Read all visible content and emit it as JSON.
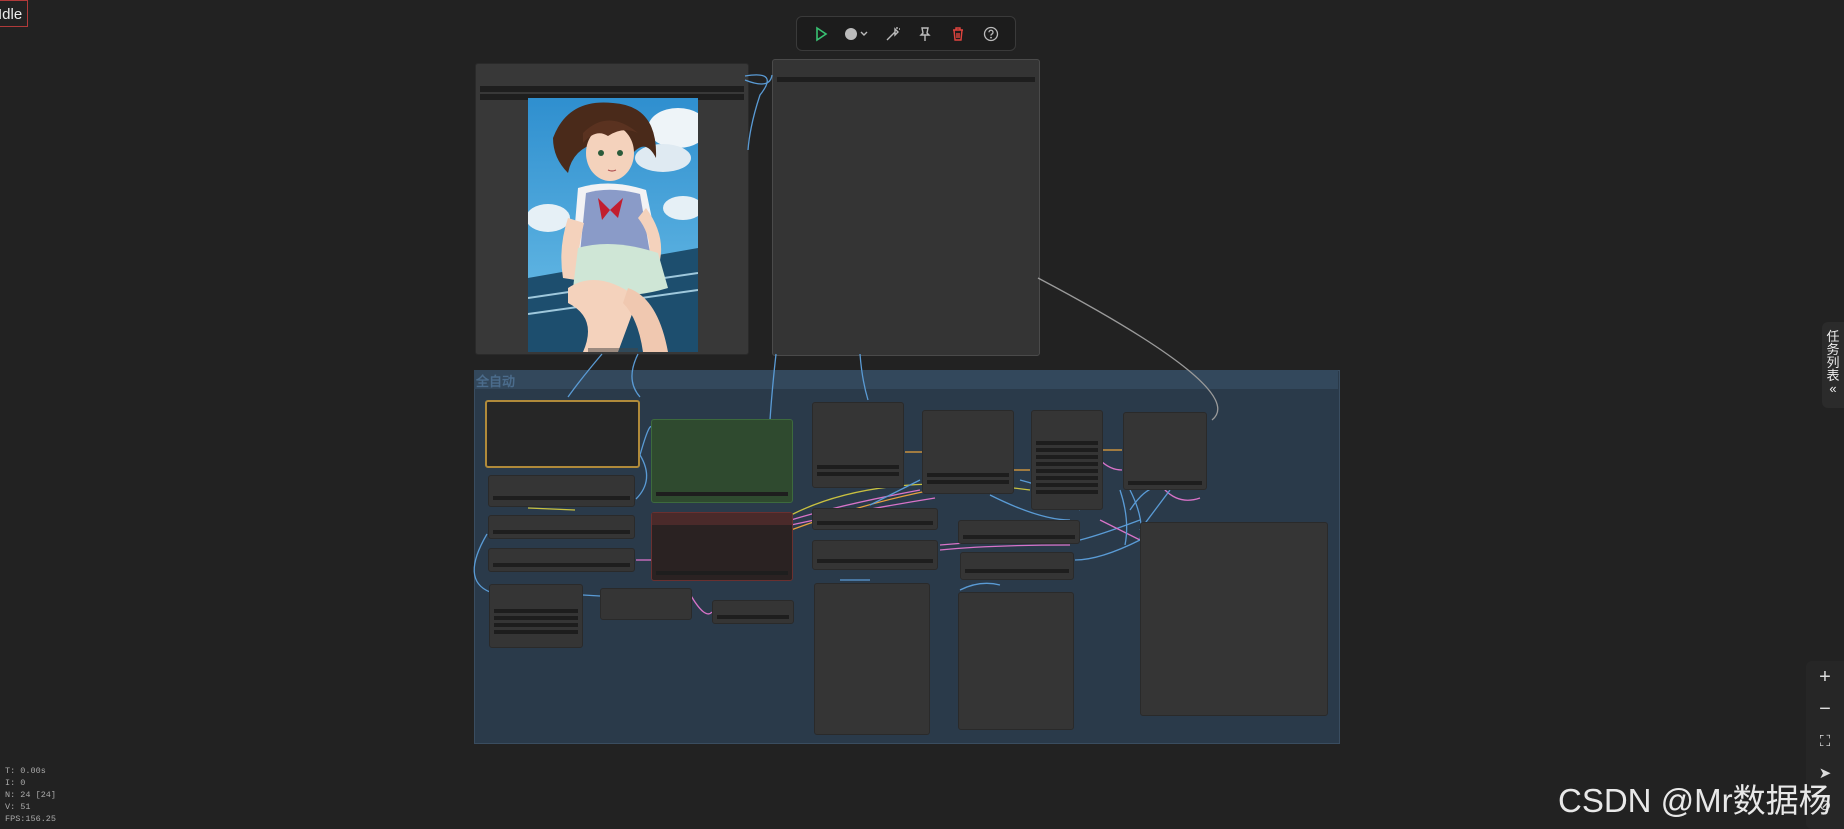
{
  "status": {
    "label": "Idle"
  },
  "toolbar": {
    "buttons": [
      {
        "icon": "play-icon",
        "color": "#38c172"
      },
      {
        "icon": "record-dropdown-icon",
        "color": "#bbbbbb"
      },
      {
        "icon": "wand-icon",
        "color": "#bbbbbb"
      },
      {
        "icon": "pin-icon",
        "color": "#bbbbbb"
      },
      {
        "icon": "trash-icon",
        "color": "#e0443e"
      },
      {
        "icon": "help-icon",
        "color": "#bbbbbb"
      }
    ]
  },
  "group": {
    "title": "全自动",
    "color": "#2a3a4a"
  },
  "right_tab": {
    "label": "任务列表",
    "collapse_glyph": "«"
  },
  "zoom": {
    "buttons": [
      {
        "icon": "zoom-in-icon",
        "glyph": "+"
      },
      {
        "icon": "zoom-out-icon",
        "glyph": "−"
      },
      {
        "icon": "fit-view-icon",
        "glyph": "⛶"
      },
      {
        "icon": "send-icon",
        "glyph": "➤"
      },
      {
        "icon": "link-visibility-icon",
        "glyph": "⊘"
      }
    ]
  },
  "stats": {
    "t": "T: 0.00s",
    "i": "I: 0",
    "n": "N: 24 [24]",
    "v": "V: 51",
    "fps": "FPS:156.25"
  },
  "watermark": "CSDN @Mr数据杨",
  "colors": {
    "link_blue": "#5a9bd5",
    "link_yellow": "#c8c040",
    "link_pink": "#d873c8",
    "link_orange": "#e6a23c",
    "positive_node": "#2f4a2f",
    "negative_node": "#4a2a2a",
    "loader_border": "#b08a3a"
  }
}
